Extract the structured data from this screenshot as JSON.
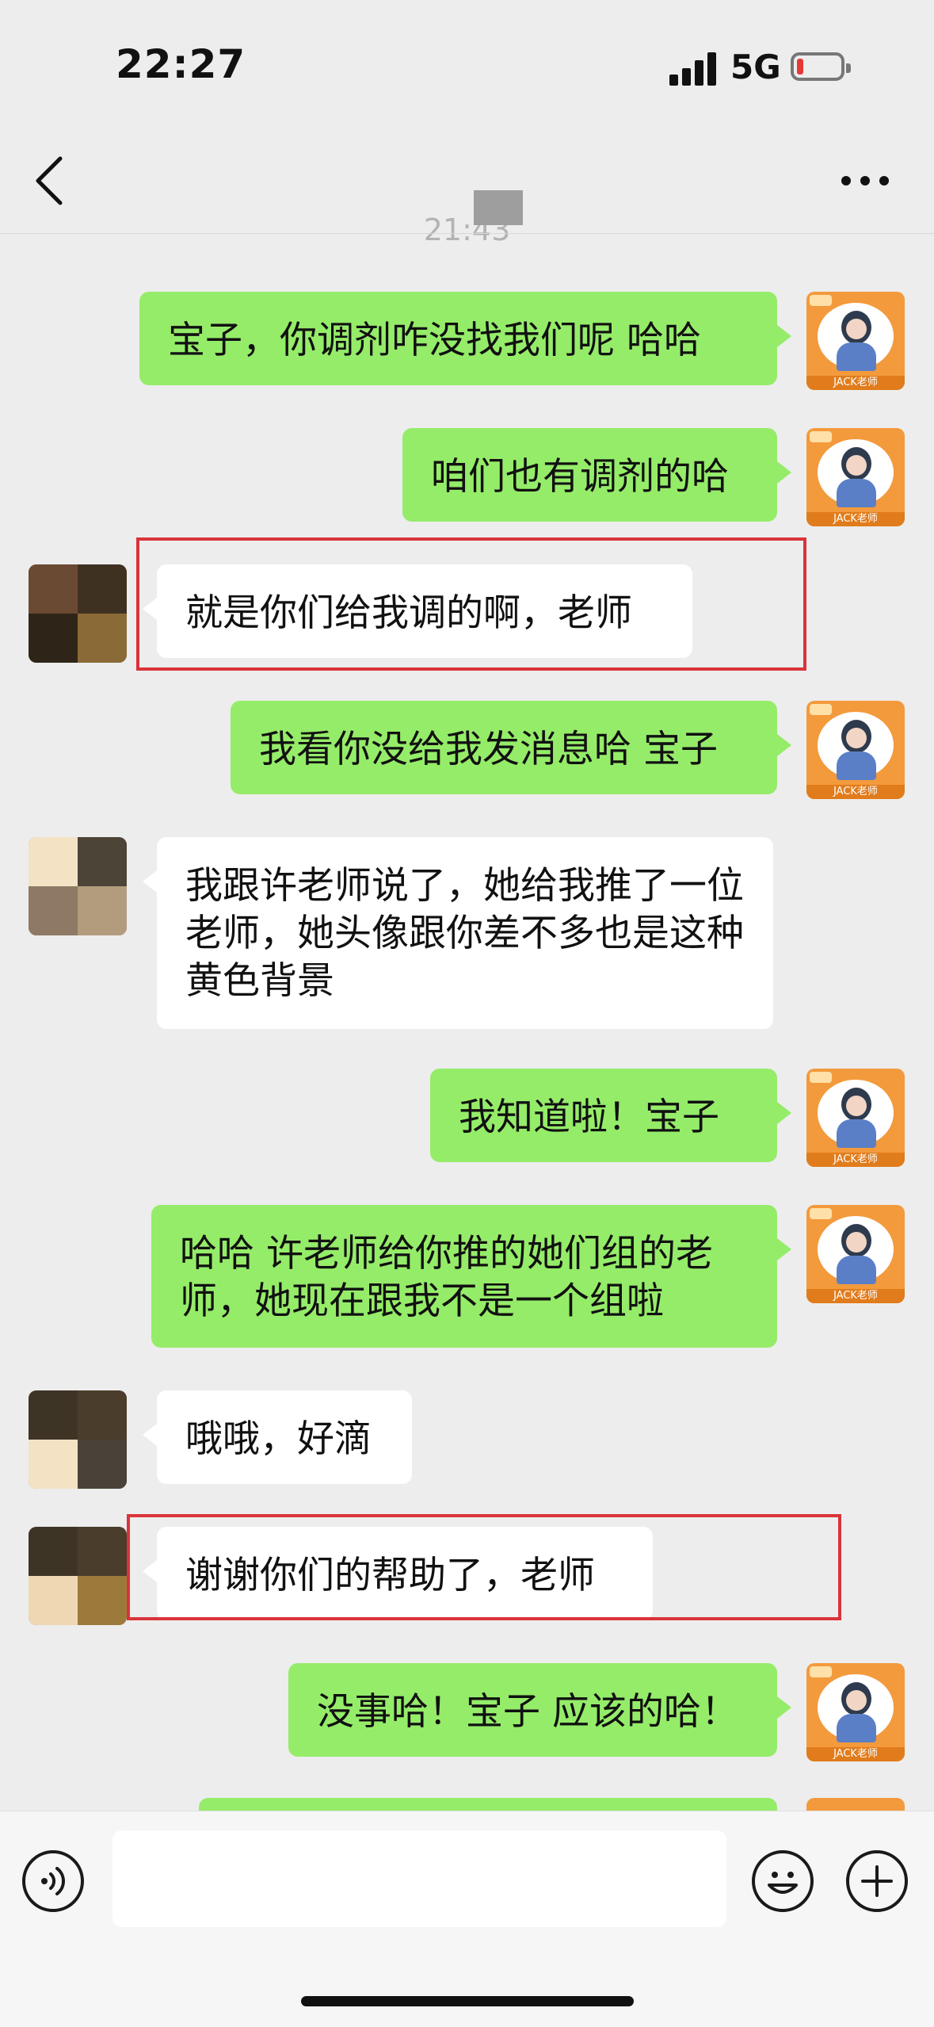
{
  "status": {
    "time": "22:27",
    "network": "5G"
  },
  "header": {
    "timestamp": "21:43"
  },
  "messages": [
    {
      "side": "me",
      "text": "宝子，你调剂咋没找我们呢 哈哈"
    },
    {
      "side": "me",
      "text": "咱们也有调剂的哈"
    },
    {
      "side": "them",
      "text": "就是你们给我调的啊，老师",
      "highlighted": true
    },
    {
      "side": "me",
      "text": "我看你没给我发消息哈 宝子"
    },
    {
      "side": "them",
      "text": "我跟许老师说了，她给我推了一位老师，她头像跟你差不多也是这种黄色背景"
    },
    {
      "side": "me",
      "text": "我知道啦！宝子"
    },
    {
      "side": "me",
      "text": "哈哈 许老师给你推的她们组的老师，她现在跟我不是一个组啦"
    },
    {
      "side": "them",
      "text": "哦哦，好滴"
    },
    {
      "side": "them",
      "text": "谢谢你们的帮助了，老师",
      "highlighted": true
    },
    {
      "side": "me",
      "text": "没事哈！宝子 应该的哈！"
    }
  ],
  "avatar_me": {
    "badge": "JACK老师"
  },
  "input": {
    "value": ""
  },
  "colors": {
    "my_bubble": "#95ec69",
    "their_bubble": "#ffffff",
    "highlight": "#d9343a",
    "background": "#ededed"
  }
}
